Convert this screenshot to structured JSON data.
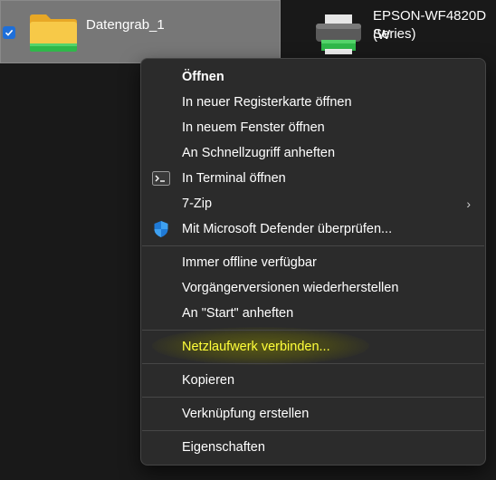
{
  "desktop": {
    "items": [
      {
        "label": "Datengrab_1",
        "selected": true,
        "icon": "folder-icon"
      },
      {
        "label_lines": [
          "EPSON-WF4820D (W",
          "Series)"
        ],
        "icon": "printer-icon"
      }
    ]
  },
  "context_menu": {
    "items": [
      {
        "label": "Öffnen",
        "bold": true
      },
      {
        "label": "In neuer Registerkarte öffnen"
      },
      {
        "label": "In neuem Fenster öffnen"
      },
      {
        "label": "An Schnellzugriff anheften"
      },
      {
        "label": "In Terminal öffnen",
        "icon": "terminal-icon"
      },
      {
        "label": "7-Zip",
        "submenu": true,
        "arrow": "›"
      },
      {
        "label": "Mit Microsoft Defender überprüfen...",
        "icon": "shield-icon"
      },
      {
        "label": "Immer offline verfügbar"
      },
      {
        "label": "Vorgängerversionen wiederherstellen"
      },
      {
        "label": "An \"Start\" anheften"
      },
      {
        "label": "Netzlaufwerk verbinden...",
        "highlighted": true
      },
      {
        "label": "Kopieren"
      },
      {
        "label": "Verknüpfung erstellen"
      },
      {
        "label": "Eigenschaften"
      }
    ]
  },
  "colors": {
    "background": "#191919",
    "menu_background": "#2b2b2b",
    "selection": "#777777",
    "accent": "#1e6fd9",
    "highlight_text": "#ffff3a"
  }
}
